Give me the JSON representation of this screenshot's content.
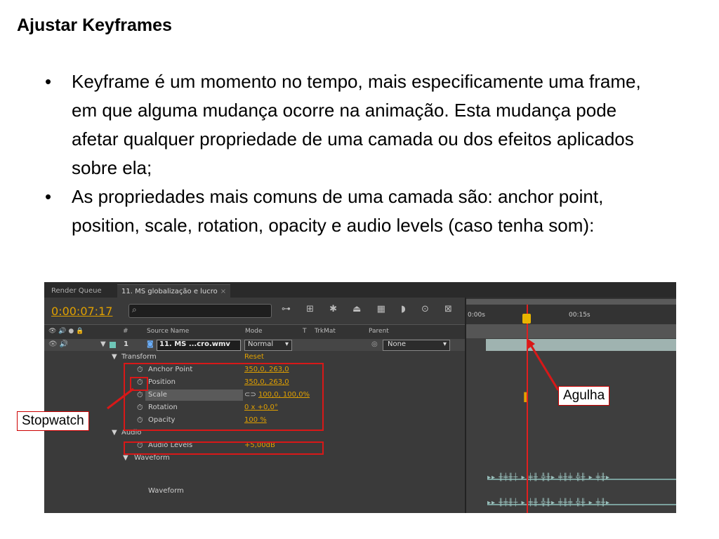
{
  "slide": {
    "title": "Ajustar Keyframes",
    "bullets": [
      "Keyframe é um momento no tempo, mais especificamente uma frame, em que alguma mudança ocorre na animação. Esta mudança pode afetar qualquer propriedade de uma camada ou dos efeitos aplicados sobre ela;",
      "As propriedades mais comuns de uma camada são: anchor point, position, scale, rotation, opacity e audio levels (caso tenha som):"
    ],
    "bullet_glyph": "•"
  },
  "ae": {
    "tabs": [
      "Render Queue",
      "11. MS globalização e lucro"
    ],
    "tab_close": "×",
    "timecode": "0:00:07:17",
    "search_icon": "⌕",
    "tool_icons": "⊶ ⊞ ✱ ⏏ ▦ ◗ ⊙ ⊠",
    "columns": {
      "number": "#",
      "source_name": "Source Name",
      "mode": "Mode",
      "t": "T",
      "trkmat": "TrkMat",
      "parent": "Parent"
    },
    "layer": {
      "number": "1",
      "name": "11. MS ...cro.wmv",
      "mode": "Normal",
      "parent": "None"
    },
    "groups": {
      "transform": "Transform",
      "transform_reset": "Reset",
      "audio": "Audio",
      "waveform_group": "Waveform",
      "waveform_item": "Waveform"
    },
    "properties": [
      {
        "name": "Anchor Point",
        "value": "350,0, 263,0"
      },
      {
        "name": "Position",
        "value": "350,0, 263,0"
      },
      {
        "name": "Scale",
        "value": "100,0, 100,0%"
      },
      {
        "name": "Rotation",
        "value": "0 x +0,0°"
      },
      {
        "name": "Opacity",
        "value": "100 %"
      }
    ],
    "audio_levels": {
      "name": "Audio Levels",
      "value": "+5,00dB"
    },
    "timeline": {
      "ruler_start": "0:00s",
      "ruler_mark": "00:15s"
    }
  },
  "callouts": {
    "needle": "Agulha",
    "stopwatch": "Stopwatch"
  },
  "colors": {
    "accent": "#e0a000",
    "highlight_red": "#d81818"
  }
}
